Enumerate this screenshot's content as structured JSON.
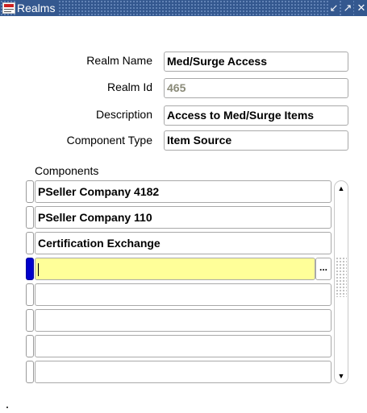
{
  "window": {
    "title": "Realms",
    "buttons": {
      "minimize": "↙",
      "maximize": "↗",
      "close": "✕"
    }
  },
  "form": {
    "realm_name": {
      "label": "Realm Name",
      "value": "Med/Surge Access"
    },
    "realm_id": {
      "label": "Realm Id",
      "value": "465"
    },
    "description": {
      "label": "Description",
      "value": "Access to Med/Surge Items"
    },
    "component_type": {
      "label": "Component Type",
      "value": "Item Source"
    }
  },
  "components": {
    "label": "Components",
    "rows": [
      {
        "value": "PSeller Company 4182"
      },
      {
        "value": "PSeller Company 110"
      },
      {
        "value": "Certification Exchange"
      },
      {
        "value": ""
      },
      {
        "value": ""
      },
      {
        "value": ""
      },
      {
        "value": ""
      },
      {
        "value": ""
      }
    ],
    "active_row": 4,
    "lov_button": "...",
    "scroll_up": "▲",
    "scroll_down": "▼"
  },
  "colors": {
    "titlebar": "#34588f",
    "active_field": "#ffff99",
    "row_indicator_active": "#0000cc",
    "disabled_text": "#8a8a78"
  }
}
